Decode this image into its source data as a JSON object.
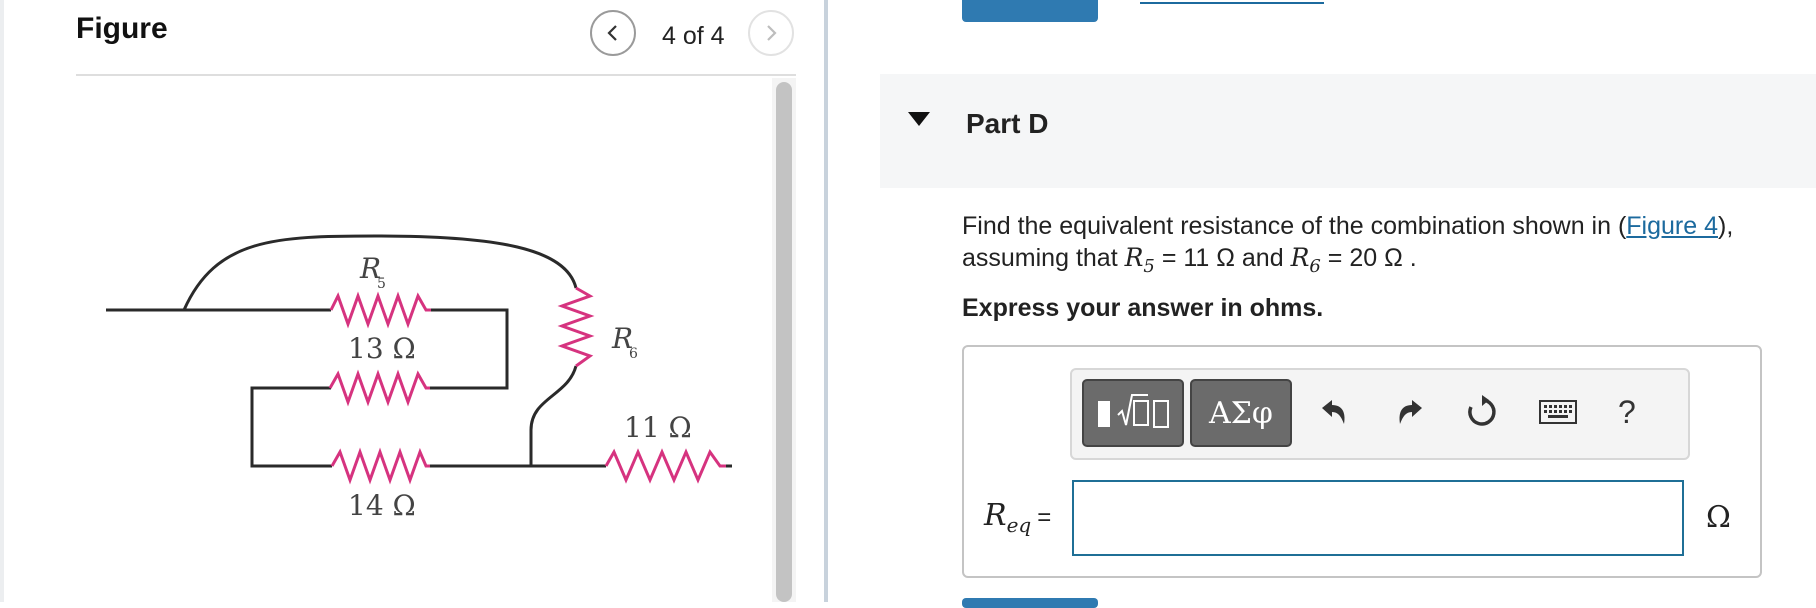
{
  "figure": {
    "title": "Figure",
    "page_indicator": "4 of 4",
    "circuit": {
      "r5_label": "R",
      "r5_sub": "5",
      "r6_label": "R",
      "r6_sub": "6",
      "r13_label": "13 Ω",
      "r14_label": "14 Ω",
      "r11_label": "11 Ω",
      "resistor_color": "#d6337f"
    }
  },
  "part": {
    "title": "Part D",
    "question_before": "Find the equivalent resistance of the combination shown in (",
    "figure_link": "Figure 4",
    "question_after": "),",
    "line2_prefix": "assuming that ",
    "r5_symbol": "R",
    "r5_sub": "5",
    "r5_value": " = 11 Ω",
    "and_text": " and ",
    "r6_symbol": "R",
    "r6_sub": "6",
    "r6_value": " = 20 Ω .",
    "instruction": "Express your answer in ohms."
  },
  "toolbar": {
    "greek_label": "ΑΣφ",
    "help_label": "?",
    "icons": [
      "templates-icon",
      "greek-symbols-icon",
      "undo-icon",
      "redo-icon",
      "reset-icon",
      "keyboard-icon",
      "help-icon"
    ]
  },
  "answer": {
    "label_symbol": "R",
    "label_sub": "eq",
    "label_eq": "=",
    "value": "",
    "unit": "Ω"
  },
  "colors": {
    "accent": "#2f7ab1",
    "link": "#1c6a9e",
    "input_border": "#1f6f96"
  }
}
